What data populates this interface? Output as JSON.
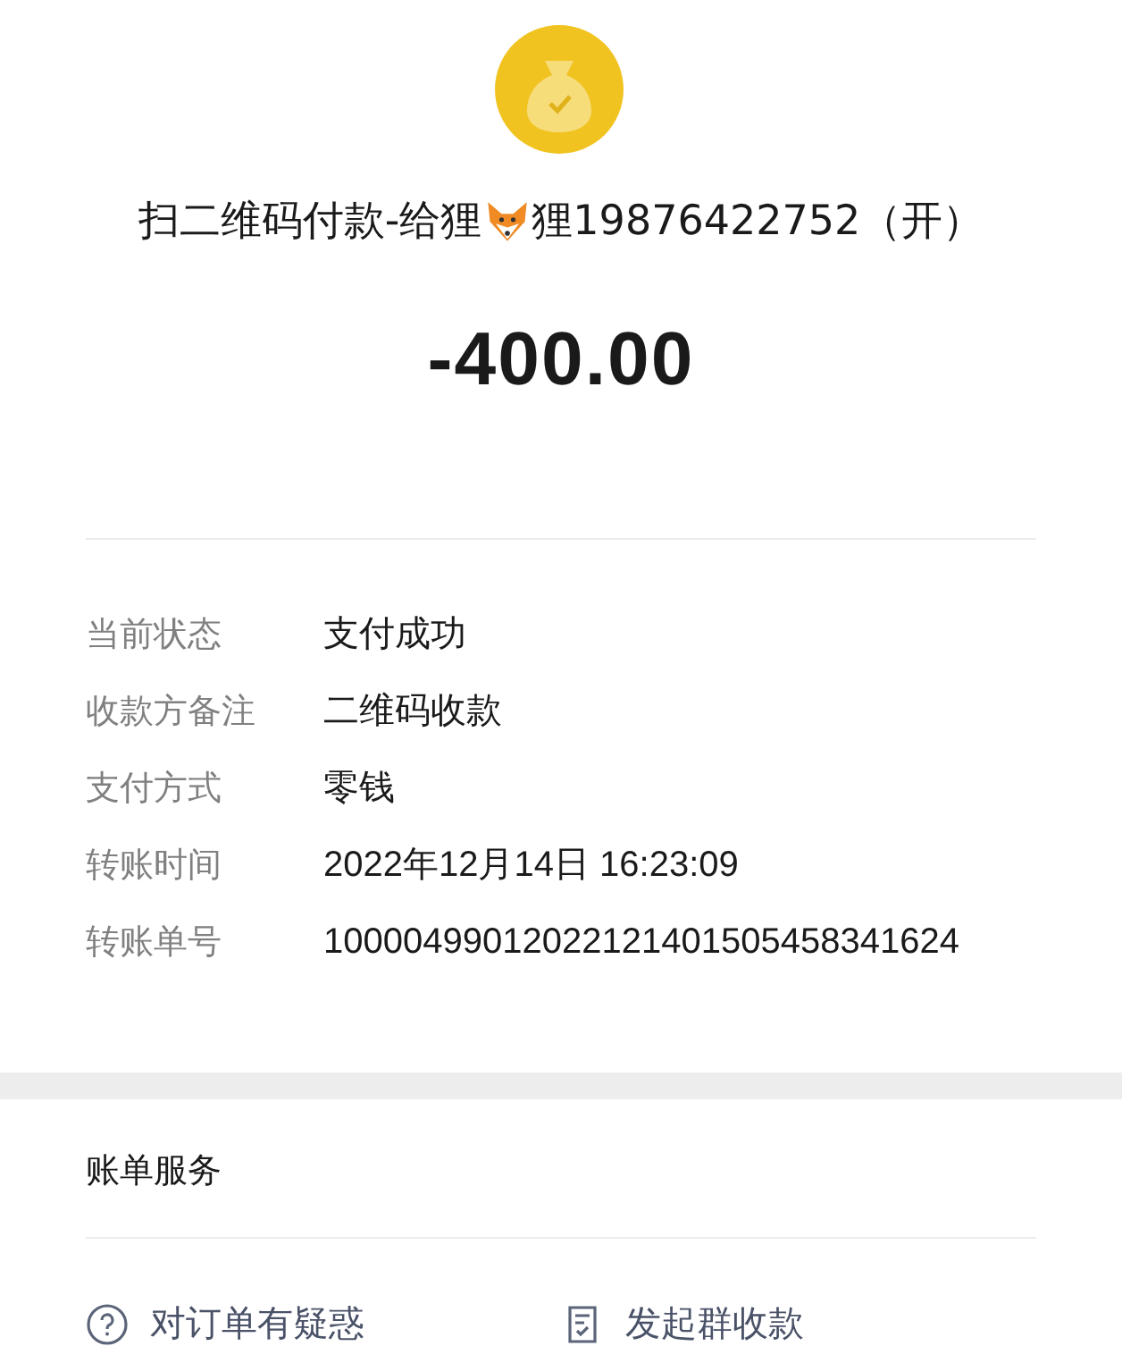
{
  "title_before": "扫二维码付款-给狸",
  "title_after": "狸19876422752（开）",
  "amount": "-400.00",
  "details": [
    {
      "label": "当前状态",
      "value": "支付成功"
    },
    {
      "label": "收款方备注",
      "value": "二维码收款"
    },
    {
      "label": "支付方式",
      "value": "零钱"
    },
    {
      "label": "转账时间",
      "value": "2022年12月14日 16:23:09"
    },
    {
      "label": "转账单号",
      "value": "10000499012022121401505458341624"
    }
  ],
  "services": {
    "title": "账单服务",
    "actions": [
      {
        "kind": "question",
        "label": "对订单有疑惑"
      },
      {
        "kind": "group",
        "label": "发起群收款"
      }
    ]
  }
}
